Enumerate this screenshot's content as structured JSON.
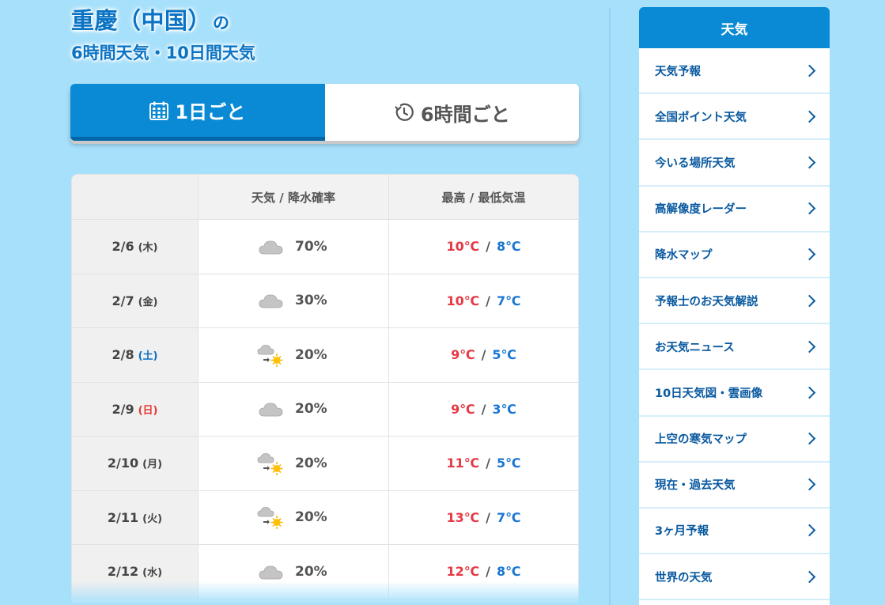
{
  "page": {
    "title_location": "重慶（中国）",
    "title_particle": "の",
    "subtitle": "6時間天気・10日間天気"
  },
  "tabs": [
    {
      "label": "1日ごと",
      "icon": "calendar-icon",
      "active": true
    },
    {
      "label": "6時間ごと",
      "icon": "clock-icon",
      "active": false
    }
  ],
  "table": {
    "header": {
      "date": "",
      "weather": "天気 / 降水確率",
      "temp": "最高 / 最低気温"
    },
    "rows": [
      {
        "date": "2/6",
        "dow": "(木)",
        "dow_type": "weekday",
        "icon": "cloud-icon",
        "prob": "70%",
        "high": "10℃",
        "low": "8℃"
      },
      {
        "date": "2/7",
        "dow": "(金)",
        "dow_type": "weekday",
        "icon": "cloud-icon",
        "prob": "30%",
        "high": "10℃",
        "low": "7℃"
      },
      {
        "date": "2/8",
        "dow": "(土)",
        "dow_type": "sat",
        "icon": "cloud-then-sun-icon",
        "prob": "20%",
        "high": "9℃",
        "low": "5℃"
      },
      {
        "date": "2/9",
        "dow": "(日)",
        "dow_type": "sun",
        "icon": "cloud-icon",
        "prob": "20%",
        "high": "9℃",
        "low": "3℃"
      },
      {
        "date": "2/10",
        "dow": "(月)",
        "dow_type": "weekday",
        "icon": "cloud-then-sun-icon",
        "prob": "20%",
        "high": "11℃",
        "low": "5℃"
      },
      {
        "date": "2/11",
        "dow": "(火)",
        "dow_type": "weekday",
        "icon": "cloud-then-sun-icon",
        "prob": "20%",
        "high": "13℃",
        "low": "7℃"
      },
      {
        "date": "2/12",
        "dow": "(水)",
        "dow_type": "weekday",
        "icon": "cloud-icon",
        "prob": "20%",
        "high": "12℃",
        "low": "8℃"
      }
    ],
    "temp_separator": "/"
  },
  "sidebar": {
    "header": "天気",
    "items": [
      {
        "label": "天気予報"
      },
      {
        "label": "全国ポイント天気"
      },
      {
        "label": "今いる場所天気"
      },
      {
        "label": "高解像度レーダー"
      },
      {
        "label": "降水マップ"
      },
      {
        "label": "予報士のお天気解説"
      },
      {
        "label": "お天気ニュース"
      },
      {
        "label": "10日天気図・雲画像"
      },
      {
        "label": "上空の寒気マップ"
      },
      {
        "label": "現在・過去天気"
      },
      {
        "label": "3ヶ月予報"
      },
      {
        "label": "世界の天気"
      }
    ]
  },
  "colors": {
    "background": "#a7e0fb",
    "accent": "#0a8ad5",
    "title": "#0a73c4",
    "high_temp": "#e53945",
    "low_temp": "#1976d2",
    "saturday": "#0a6fc0",
    "sunday": "#e53935"
  }
}
